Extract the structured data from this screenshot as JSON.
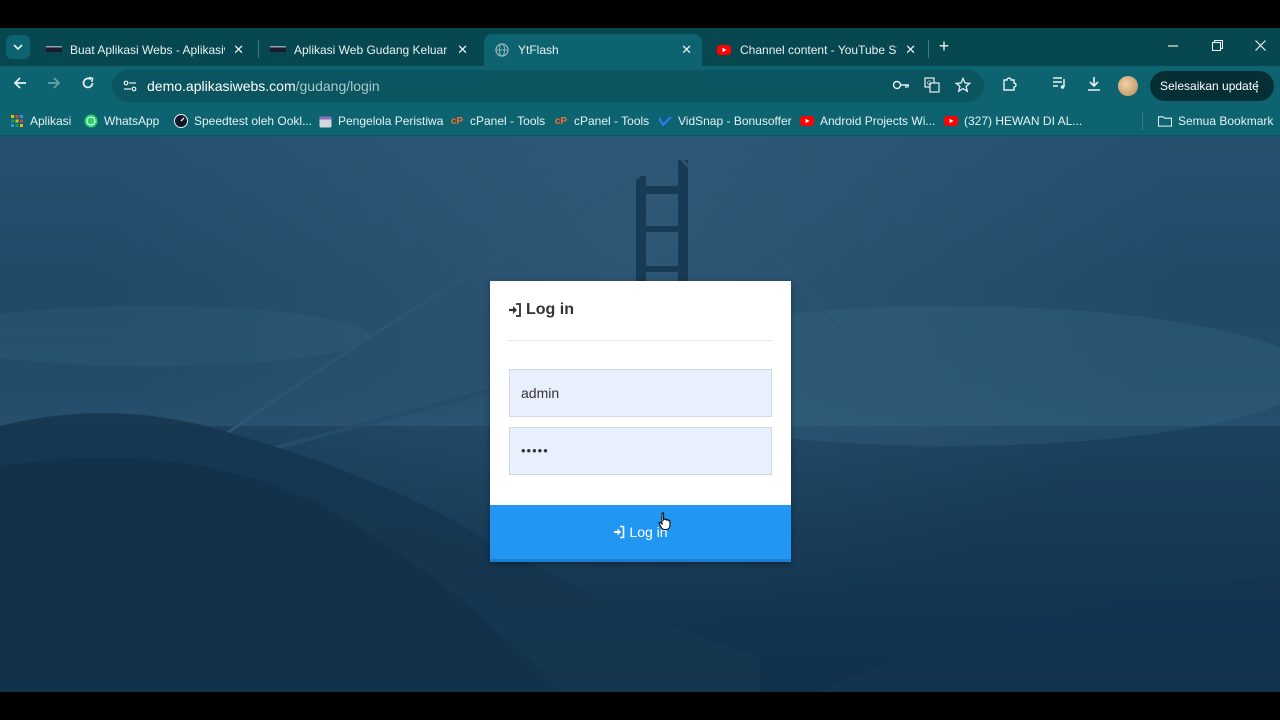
{
  "browser": {
    "tabs": [
      {
        "title": "Buat Aplikasi Webs - Aplikasiwe",
        "active": false,
        "favicon": "site-dark-icon"
      },
      {
        "title": "Aplikasi Web Gudang Keluar M",
        "active": false,
        "favicon": "site-dark-icon"
      },
      {
        "title": "YtFlash",
        "active": true,
        "favicon": "globe-icon"
      },
      {
        "title": "Channel content - YouTube Stu",
        "active": false,
        "favicon": "youtube-icon"
      }
    ],
    "url_host": "demo.aplikasiwebs.com",
    "url_path": "/gudang/login",
    "update_label": "Selesaikan update",
    "bookmarks": [
      {
        "label": "Aplikasi",
        "icon": "apps-grid-icon"
      },
      {
        "label": "WhatsApp",
        "icon": "whatsapp-icon"
      },
      {
        "label": "Speedtest oleh Ookl...",
        "icon": "speedtest-icon"
      },
      {
        "label": "Pengelola Peristiwa",
        "icon": "calendar-icon"
      },
      {
        "label": "cPanel - Tools",
        "icon": "cpanel-icon"
      },
      {
        "label": "cPanel - Tools",
        "icon": "cpanel-icon"
      },
      {
        "label": "VidSnap - Bonusoffer",
        "icon": "vidsnap-icon"
      },
      {
        "label": "Android Projects Wi...",
        "icon": "youtube-icon"
      },
      {
        "label": "(327) HEWAN DI AL...",
        "icon": "youtube-icon"
      }
    ],
    "all_bookmarks_label": "Semua Bookmark"
  },
  "login": {
    "title": "Log in",
    "username_value": "admin",
    "password_value": "•••••",
    "button_label": "Log in"
  },
  "colors": {
    "browser_frame": "#0d6470",
    "login_button": "#2196f3",
    "input_bg": "#e8f0fe"
  }
}
